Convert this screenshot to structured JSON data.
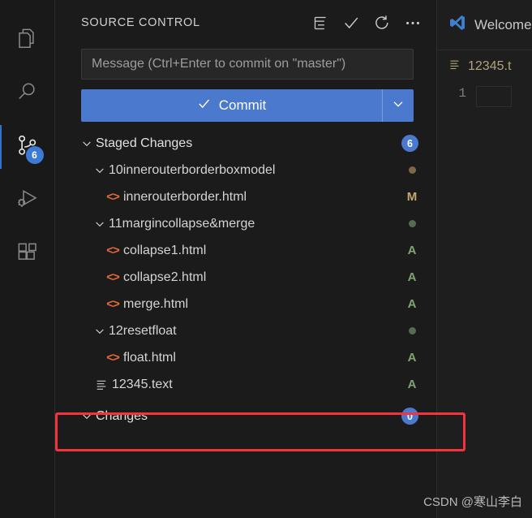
{
  "colors": {
    "accent_blue": "#4a79ce",
    "badge_blue": "#3d7ad6",
    "highlight_red": "#f5333f",
    "modified_dot": "#7a6a48",
    "added_dot": "#556b52",
    "status_m": "#c3a96f",
    "status_a": "#7fa472",
    "html_icon": "#e06c3b",
    "sidebar_bg": "#1b1b1b",
    "activitybar_bg": "#191919",
    "editor_bg": "#1e1e1e"
  },
  "activity_bar": {
    "items": [
      {
        "name": "explorer",
        "icon": "files-icon",
        "active": false,
        "badge": ""
      },
      {
        "name": "search",
        "icon": "search-icon",
        "active": false,
        "badge": ""
      },
      {
        "name": "source-control",
        "icon": "source-control-icon",
        "active": true,
        "badge": "6"
      },
      {
        "name": "run-and-debug",
        "icon": "run-debug-icon",
        "active": false,
        "badge": ""
      },
      {
        "name": "extensions",
        "icon": "extensions-icon",
        "active": false,
        "badge": ""
      }
    ]
  },
  "source_control": {
    "title": "SOURCE CONTROL",
    "actions": [
      {
        "name": "view-as-tree",
        "icon": "list-tree-icon"
      },
      {
        "name": "commit",
        "icon": "check-icon"
      },
      {
        "name": "refresh",
        "icon": "refresh-icon"
      },
      {
        "name": "more-actions",
        "icon": "ellipsis-icon"
      }
    ],
    "message_input": {
      "placeholder": "Message (Ctrl+Enter to commit on \"master\")",
      "value": ""
    },
    "commit_button": {
      "label": "Commit",
      "dropdown_icon": "chevron-down-icon"
    },
    "groups": [
      {
        "label": "Staged Changes",
        "count": "6",
        "expanded": true,
        "children": [
          {
            "label": "10innerouterborderboxmodel",
            "type": "folder",
            "expanded": true,
            "dot": "modified",
            "children": [
              {
                "label": "innerouterborder.html",
                "type": "html",
                "status": "M"
              }
            ]
          },
          {
            "label": "11margincollapse&merge",
            "type": "folder",
            "expanded": true,
            "dot": "added",
            "children": [
              {
                "label": "collapse1.html",
                "type": "html",
                "status": "A"
              },
              {
                "label": "collapse2.html",
                "type": "html",
                "status": "A"
              },
              {
                "label": "merge.html",
                "type": "html",
                "status": "A"
              }
            ]
          },
          {
            "label": "12resetfloat",
            "type": "folder",
            "expanded": true,
            "dot": "added",
            "children": [
              {
                "label": "float.html",
                "type": "html",
                "status": "A"
              }
            ]
          },
          {
            "label": "12345.text",
            "type": "text",
            "status": "A",
            "indent": 0
          }
        ]
      },
      {
        "label": "Changes",
        "count": "0",
        "expanded": true,
        "highlighted": true,
        "children": []
      }
    ]
  },
  "editor": {
    "tab": {
      "label": "Welcome",
      "icon": "vscode-logo-icon"
    },
    "breadcrumb": {
      "label": "12345.t",
      "icon": "text-file-icon"
    },
    "line_numbers": [
      "1"
    ]
  },
  "watermark": "CSDN @寒山李白"
}
